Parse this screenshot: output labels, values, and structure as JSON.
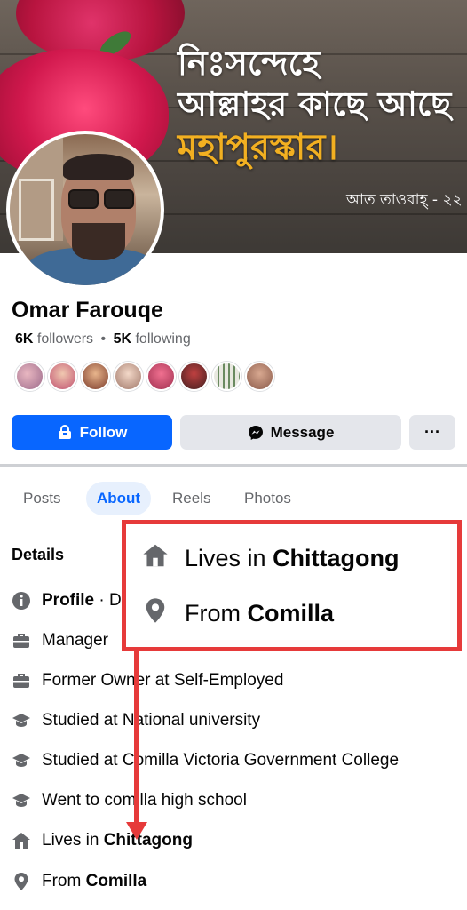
{
  "cover": {
    "line1": "নিঃসন্দেহে",
    "line2": "আল্লাহর কাছে আছে",
    "line3": "মহাপুরস্কার।",
    "reference": "আত তাওবাহ্ - ২২",
    "accent": "#f2b021"
  },
  "profile": {
    "name": "Omar Farouqe",
    "followers_count": "6K",
    "followers_label": "followers",
    "separator": "•",
    "following_count": "5K",
    "following_label": "following"
  },
  "actions": {
    "follow": "Follow",
    "message": "Message",
    "more": "···"
  },
  "tabs": [
    {
      "label": "Posts"
    },
    {
      "label": "About"
    },
    {
      "label": "Reels"
    },
    {
      "label": "Photos"
    }
  ],
  "details": {
    "title": "Details",
    "profile_prefix": "Profile",
    "profile_suffix": "· D",
    "manager": "Manager",
    "former_owner": "Former Owner at Self-Employed",
    "studied1": "Studied at National university",
    "studied2": "Studied at Comilla Victoria Government College",
    "went_to": "Went to comilla high school",
    "lives_prefix": "Lives in",
    "lives_place": "Chittagong",
    "from_prefix": "From",
    "from_place": "Comilla"
  },
  "callout": {
    "lives_prefix": "Lives in",
    "lives_place": "Chittagong",
    "from_prefix": "From",
    "from_place": "Comilla",
    "color": "#e63a3a"
  },
  "colors": {
    "primary": "#0866ff",
    "secondary_bg": "#e4e6eb",
    "muted_text": "#65676b"
  }
}
